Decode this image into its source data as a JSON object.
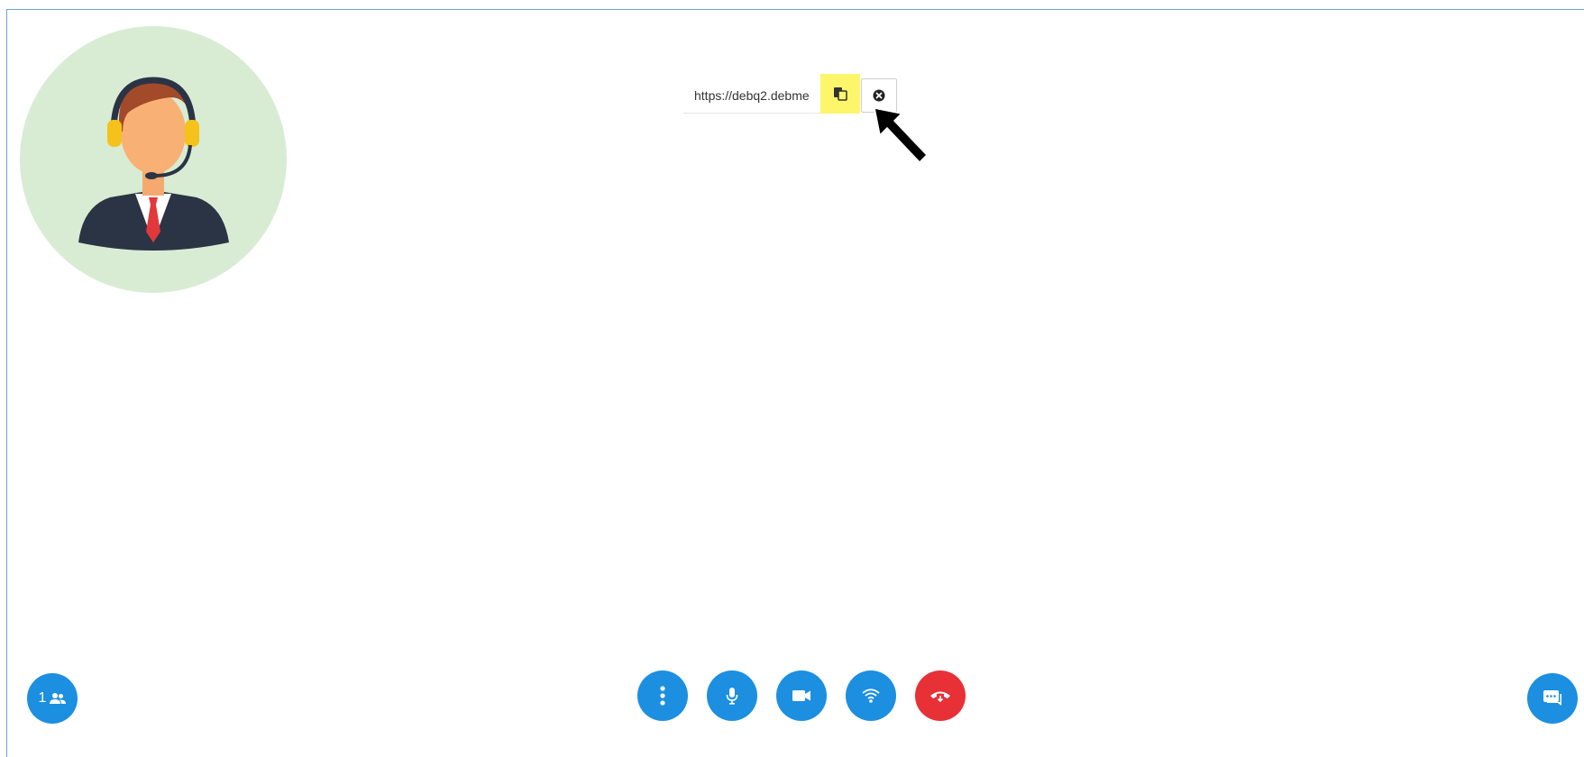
{
  "share_link": {
    "url_text": "https://debq2.debme",
    "copy_icon": "clipboard-copy-icon",
    "close_icon": "close-circle-icon"
  },
  "participants": {
    "count": "1",
    "icon": "people-icon"
  },
  "controls": {
    "more_icon": "vertical-dots-icon",
    "mic_icon": "microphone-icon",
    "camera_icon": "video-camera-icon",
    "network_icon": "wifi-icon",
    "hangup_icon": "phone-hangup-icon",
    "chat_icon": "chat-icon"
  },
  "colors": {
    "accent_blue": "#1c8fe0",
    "hangup_red": "#e83037",
    "highlight_yellow": "#fdf66b",
    "avatar_bg": "#d8ecd4"
  }
}
